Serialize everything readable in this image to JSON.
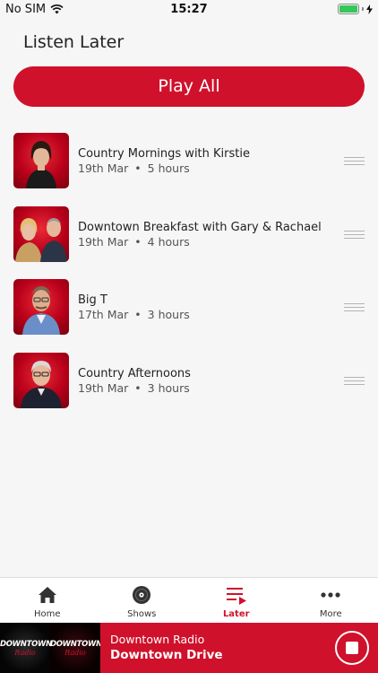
{
  "status_bar": {
    "carrier": "No SIM",
    "time": "15:27"
  },
  "page": {
    "title": "Listen Later",
    "play_all_label": "Play All"
  },
  "episodes": [
    {
      "title": "Country Mornings with Kirstie",
      "date": "19th Mar",
      "duration": "5 hours"
    },
    {
      "title": "Downtown Breakfast with Gary & Rachael",
      "date": "19th Mar",
      "duration": "4 hours"
    },
    {
      "title": "Big T",
      "date": "17th Mar",
      "duration": "3 hours"
    },
    {
      "title": "Country Afternoons",
      "date": "19th Mar",
      "duration": "3 hours"
    }
  ],
  "meta_separator": "•",
  "tab_bar": {
    "tabs": [
      {
        "label": "Home",
        "icon": "home-icon",
        "active": false
      },
      {
        "label": "Shows",
        "icon": "disc-icon",
        "active": false
      },
      {
        "label": "Later",
        "icon": "playlist-icon",
        "active": true
      },
      {
        "label": "More",
        "icon": "more-icon",
        "active": false
      }
    ]
  },
  "now_playing": {
    "logo_text": "DOWNTOWN",
    "logo_subtext": "Radio",
    "station": "Downtown Radio",
    "show": "Downtown Drive"
  },
  "colors": {
    "accent": "#d0112b",
    "background": "#f6f6f6",
    "battery": "#35c759"
  }
}
